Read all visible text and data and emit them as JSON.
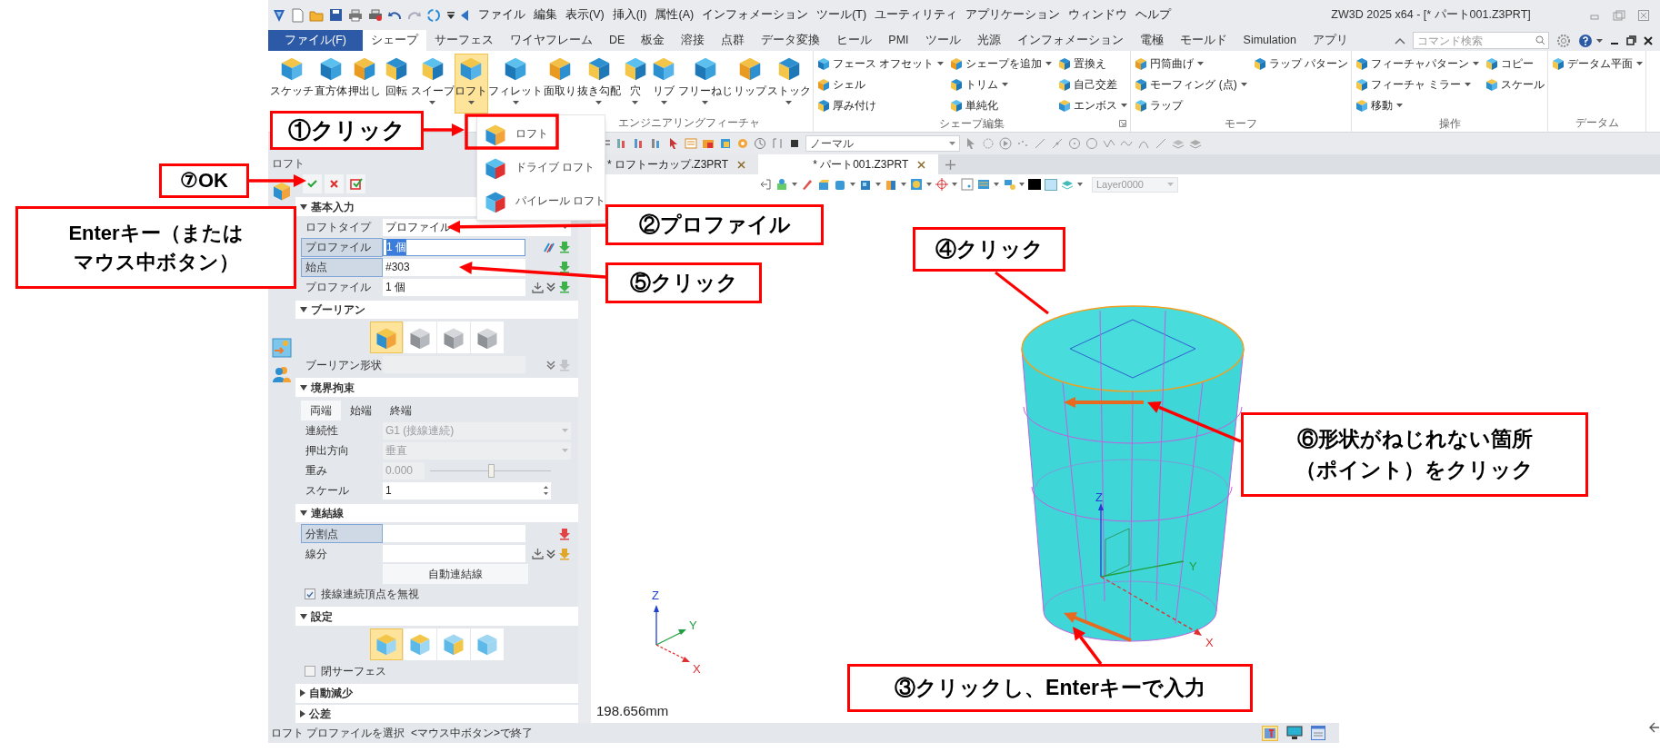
{
  "title_bar": {
    "menu": [
      "ファイル",
      "編集",
      "表示(V)",
      "挿入(I)",
      "属性(A)",
      "インフォメーション",
      "ツール(T)",
      "ユーティリティ",
      "アプリケーション",
      "ウィンドウ",
      "ヘルプ"
    ],
    "title": "ZW3D 2025 x64 - [* パート001.Z3PRT]"
  },
  "ribbon_tabs": [
    {
      "label": "ファイル(F)",
      "kind": "file",
      "selected": false
    },
    {
      "label": "シェープ",
      "kind": "tab",
      "selected": true
    },
    {
      "label": "サーフェス",
      "kind": "tab",
      "selected": false
    },
    {
      "label": "ワイヤフレーム",
      "kind": "tab",
      "selected": false
    },
    {
      "label": "DE",
      "kind": "tab",
      "selected": false
    },
    {
      "label": "板金",
      "kind": "tab",
      "selected": false
    },
    {
      "label": "溶接",
      "kind": "tab",
      "selected": false
    },
    {
      "label": "点群",
      "kind": "tab",
      "selected": false
    },
    {
      "label": "データ変換",
      "kind": "tab",
      "selected": false
    },
    {
      "label": "ヒール",
      "kind": "tab",
      "selected": false
    },
    {
      "label": "PMI",
      "kind": "tab",
      "selected": false
    },
    {
      "label": "ツール",
      "kind": "tab",
      "selected": false
    },
    {
      "label": "光源",
      "kind": "tab",
      "selected": false
    },
    {
      "label": "インフォメーション",
      "kind": "tab",
      "selected": false
    },
    {
      "label": "電極",
      "kind": "tab",
      "selected": false
    },
    {
      "label": "モールド",
      "kind": "tab",
      "selected": false
    },
    {
      "label": "Simulation",
      "kind": "tab",
      "selected": false
    },
    {
      "label": "アプリ",
      "kind": "tab",
      "selected": false
    }
  ],
  "command_search": {
    "placeholder": "コマンド検索"
  },
  "ribbon_groups": [
    {
      "title": "エンジニアリングフィーチャ",
      "kind": "large",
      "buttons": [
        {
          "label": "スケッチ",
          "dropdown": false,
          "selected": false
        },
        {
          "label": "直方体",
          "dropdown": false,
          "selected": false
        },
        {
          "label": "押出し",
          "dropdown": false,
          "selected": false
        },
        {
          "label": "回転",
          "dropdown": false,
          "selected": false
        },
        {
          "label": "スイープ",
          "dropdown": true,
          "selected": false
        },
        {
          "label": "ロフト",
          "dropdown": true,
          "selected": true
        },
        {
          "label": "フィレット",
          "dropdown": true,
          "selected": false
        },
        {
          "label": "面取り",
          "dropdown": false,
          "selected": false
        },
        {
          "label": "抜き勾配",
          "dropdown": true,
          "selected": false
        },
        {
          "label": "穴",
          "dropdown": true,
          "selected": false
        },
        {
          "label": "リブ",
          "dropdown": true,
          "selected": false
        },
        {
          "label": "フリーねじ",
          "dropdown": true,
          "selected": false
        },
        {
          "label": "リップ",
          "dropdown": false,
          "selected": false
        },
        {
          "label": "ストック",
          "dropdown": true,
          "selected": false
        }
      ]
    },
    {
      "title": "シェープ編集",
      "kind": "small",
      "launcher": true,
      "columns": [
        [
          {
            "label": "フェース オフセット",
            "dropdown": true
          },
          {
            "label": "シェル",
            "dropdown": false
          },
          {
            "label": "厚み付け",
            "dropdown": false
          }
        ],
        [
          {
            "label": "シェープを追加",
            "dropdown": true
          },
          {
            "label": "トリム",
            "dropdown": true
          },
          {
            "label": "単純化",
            "dropdown": false
          }
        ],
        [
          {
            "label": "置換え",
            "dropdown": false
          },
          {
            "label": "自己交差",
            "dropdown": false
          },
          {
            "label": "エンボス",
            "dropdown": true
          }
        ]
      ]
    },
    {
      "title": "モーフ",
      "kind": "small",
      "launcher": false,
      "columns": [
        [
          {
            "label": "円筒曲げ",
            "dropdown": true
          },
          {
            "label": "モーフィング (点)",
            "dropdown": true
          },
          {
            "label": "ラップ",
            "dropdown": false
          }
        ],
        [
          {
            "label": "ラップ パターン",
            "dropdown": false
          }
        ]
      ]
    },
    {
      "title": "操作",
      "kind": "small",
      "launcher": false,
      "columns": [
        [
          {
            "label": "フィーチャパターン",
            "dropdown": true
          },
          {
            "label": "フィーチャ ミラー",
            "dropdown": true
          },
          {
            "label": "移動",
            "dropdown": true
          }
        ],
        [
          {
            "label": "コピー",
            "dropdown": false
          },
          {
            "label": "スケール",
            "dropdown": false
          }
        ]
      ]
    },
    {
      "title": "データム",
      "kind": "small",
      "launcher": false,
      "columns": [
        [
          {
            "label": "データム平面",
            "dropdown": true
          }
        ]
      ]
    }
  ],
  "loft_menu": [
    {
      "label": "ロフト"
    },
    {
      "label": "ドライブ ロフト"
    },
    {
      "label": "パイレール ロフト"
    }
  ],
  "doc_toolbar": {
    "render_mode": "ノーマル"
  },
  "doc_tabs": [
    {
      "label": "* ロフトーカップ.Z3PRT",
      "selected": false
    },
    {
      "label": "* パート001.Z3PRT",
      "selected": true
    }
  ],
  "view_toolbar": {
    "layer": "Layer0000"
  },
  "panel": {
    "title": "ロフト",
    "sections": [
      {
        "title": "基本入力",
        "expanded": true,
        "rows": [
          {
            "kind": "select",
            "label": "ロフトタイプ",
            "value": "プロファイル",
            "disabled": false
          },
          {
            "kind": "input",
            "label": "プロファイル",
            "value": "1 個",
            "active": true,
            "value_selected": true,
            "disabled": false
          },
          {
            "kind": "input",
            "label": "始点",
            "value": "#303",
            "active": true,
            "value_selected": false,
            "disabled": false
          },
          {
            "kind": "input",
            "label": "プロファイル",
            "value": "1 個",
            "active": false,
            "value_selected": false,
            "disabled": false
          }
        ]
      },
      {
        "title": "ブーリアン",
        "expanded": true,
        "rows": [
          {
            "kind": "icons",
            "choices": [
              {
                "selected": true
              },
              {
                "selected": false
              },
              {
                "selected": false
              },
              {
                "selected": false
              }
            ]
          },
          {
            "kind": "input",
            "label": "ブーリアン形状",
            "active": false,
            "value_selected": false,
            "disabled": true
          }
        ]
      },
      {
        "title": "境界拘束",
        "expanded": true,
        "rows": [
          {
            "kind": "tabs",
            "tabs": [
              {
                "label": "両端",
                "selected": true
              },
              {
                "label": "始端",
                "selected": false
              },
              {
                "label": "終端",
                "selected": false
              }
            ]
          },
          {
            "kind": "select",
            "label": "連続性",
            "value": "G1 (接線連続)",
            "disabled": true
          },
          {
            "kind": "select",
            "label": "押出方向",
            "value": "垂直",
            "disabled": true
          },
          {
            "kind": "slider",
            "label": "重み",
            "value": "0.000",
            "level": 0.5,
            "disabled": true
          },
          {
            "kind": "spin",
            "label": "スケール",
            "value": "1",
            "disabled": false
          }
        ]
      },
      {
        "title": "連結線",
        "expanded": true,
        "rows": [
          {
            "kind": "input",
            "label": "分割点",
            "active": true,
            "value_selected": false,
            "disabled": false
          },
          {
            "kind": "input",
            "label": "線分",
            "active": false,
            "value_selected": false,
            "disabled": false
          },
          {
            "kind": "button",
            "label": "自動連結線"
          },
          {
            "kind": "checkbox",
            "label": "接線連続頂点を無視",
            "checked": true
          }
        ]
      },
      {
        "title": "設定",
        "expanded": true,
        "rows": [
          {
            "kind": "icons",
            "choices": [
              {
                "selected": true
              },
              {
                "selected": false
              },
              {
                "selected": false
              },
              {
                "selected": false
              }
            ]
          },
          {
            "kind": "checkbox",
            "label": "閉サーフェス",
            "checked": false
          }
        ]
      },
      {
        "title": "自動減少",
        "expanded": false
      },
      {
        "title": "公差",
        "expanded": false
      }
    ]
  },
  "viewport": {
    "measurement": "198.656mm",
    "triad_labels": [
      "Z",
      "Y",
      "X"
    ],
    "model_axis_labels": [
      "Z",
      "Y",
      "X"
    ]
  },
  "status_bar": {
    "text": "ロフト プロファイルを選択  <マウス中ボタン>で終了"
  },
  "callouts": [
    {
      "lines": [
        "①クリック"
      ]
    },
    {
      "lines": [
        "⑦OK"
      ]
    },
    {
      "lines": [
        "Enterキー（または",
        "マウス中ボタン）"
      ]
    },
    {
      "lines": [
        "②プロファイル"
      ]
    },
    {
      "lines": [
        "⑤クリック"
      ]
    },
    {
      "lines": [
        "④クリック"
      ]
    },
    {
      "lines": [
        "⑥形状がねじれない箇所",
        "（ポイント）をクリック"
      ]
    },
    {
      "lines": [
        "③クリックし、Enterキーで入力"
      ]
    }
  ]
}
